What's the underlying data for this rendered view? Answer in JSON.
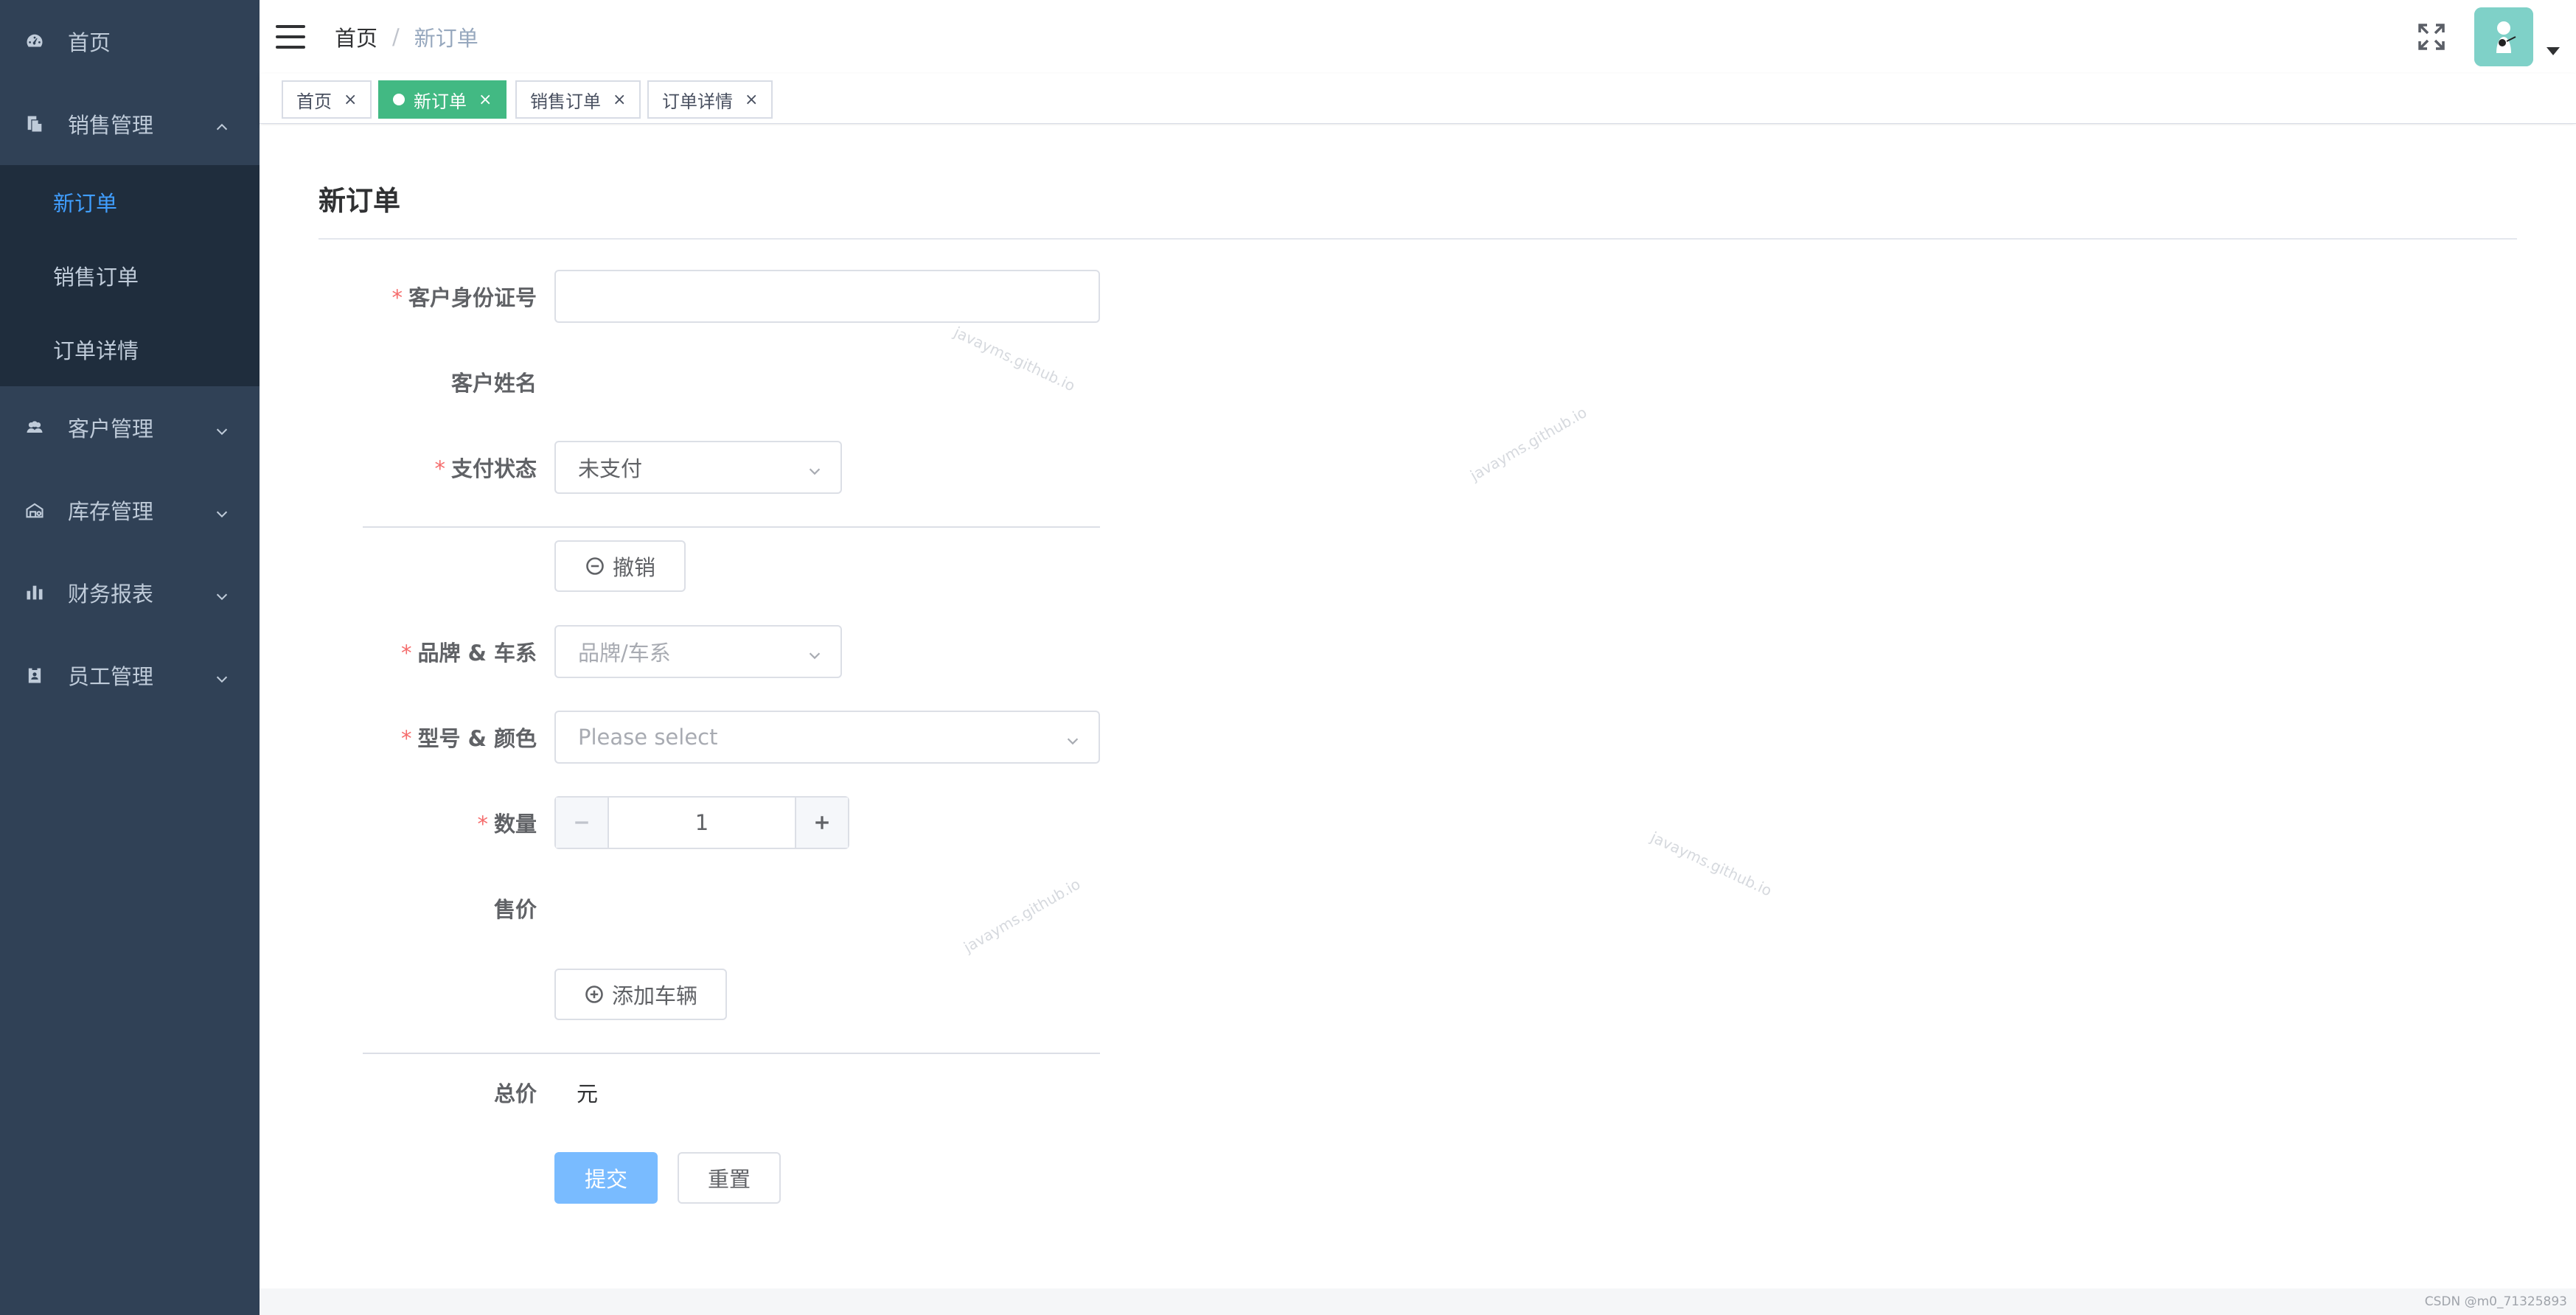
{
  "sidebar": {
    "items": [
      {
        "label": "首页",
        "icon": "dashboard-icon"
      },
      {
        "label": "销售管理",
        "icon": "documents-icon",
        "expanded": true
      },
      {
        "label": "客户管理",
        "icon": "users-icon"
      },
      {
        "label": "库存管理",
        "icon": "warehouse-icon"
      },
      {
        "label": "财务报表",
        "icon": "chart-icon"
      },
      {
        "label": "员工管理",
        "icon": "badge-icon"
      }
    ],
    "submenu": [
      {
        "label": "新订单",
        "active": true
      },
      {
        "label": "销售订单"
      },
      {
        "label": "订单详情"
      }
    ],
    "colors": {
      "bg": "#304156",
      "submenu_bg": "#1f2d3d",
      "active": "#409eff"
    }
  },
  "navbar": {
    "breadcrumb": [
      "首页",
      "新订单"
    ],
    "separator": "/"
  },
  "tags": [
    {
      "label": "首页",
      "close": "×"
    },
    {
      "label": "新订单",
      "close": "×",
      "active": true
    },
    {
      "label": "销售订单",
      "close": "×"
    },
    {
      "label": "订单详情",
      "close": "×"
    }
  ],
  "tag_active_color": "#42b983",
  "page": {
    "title": "新订单",
    "fields": {
      "id_number": {
        "label": "客户身份证号",
        "required": "*",
        "value": ""
      },
      "customer_name": {
        "label": "客户姓名",
        "value": ""
      },
      "payment_status": {
        "label": "支付状态",
        "required": "*",
        "value": "未支付"
      },
      "cancel_button": "撤销",
      "brand_series": {
        "label": "品牌 & 车系",
        "required": "*",
        "placeholder": "品牌/车系"
      },
      "model_color": {
        "label": "型号 & 颜色",
        "required": "*",
        "placeholder": "Please select"
      },
      "quantity": {
        "label": "数量",
        "required": "*",
        "value": "1"
      },
      "price": {
        "label": "售价",
        "value": ""
      },
      "add_vehicle_button": "添加车辆",
      "total": {
        "label": "总价",
        "value": "元"
      }
    },
    "submit_label": "提交",
    "reset_label": "重置",
    "primary_color": "#79bbff"
  },
  "watermarks": [
    "javayms.github.io",
    "javayms.github.io",
    "javayms.github.io",
    "javayms.github.io"
  ],
  "footer_credit": "CSDN @m0_71325893"
}
